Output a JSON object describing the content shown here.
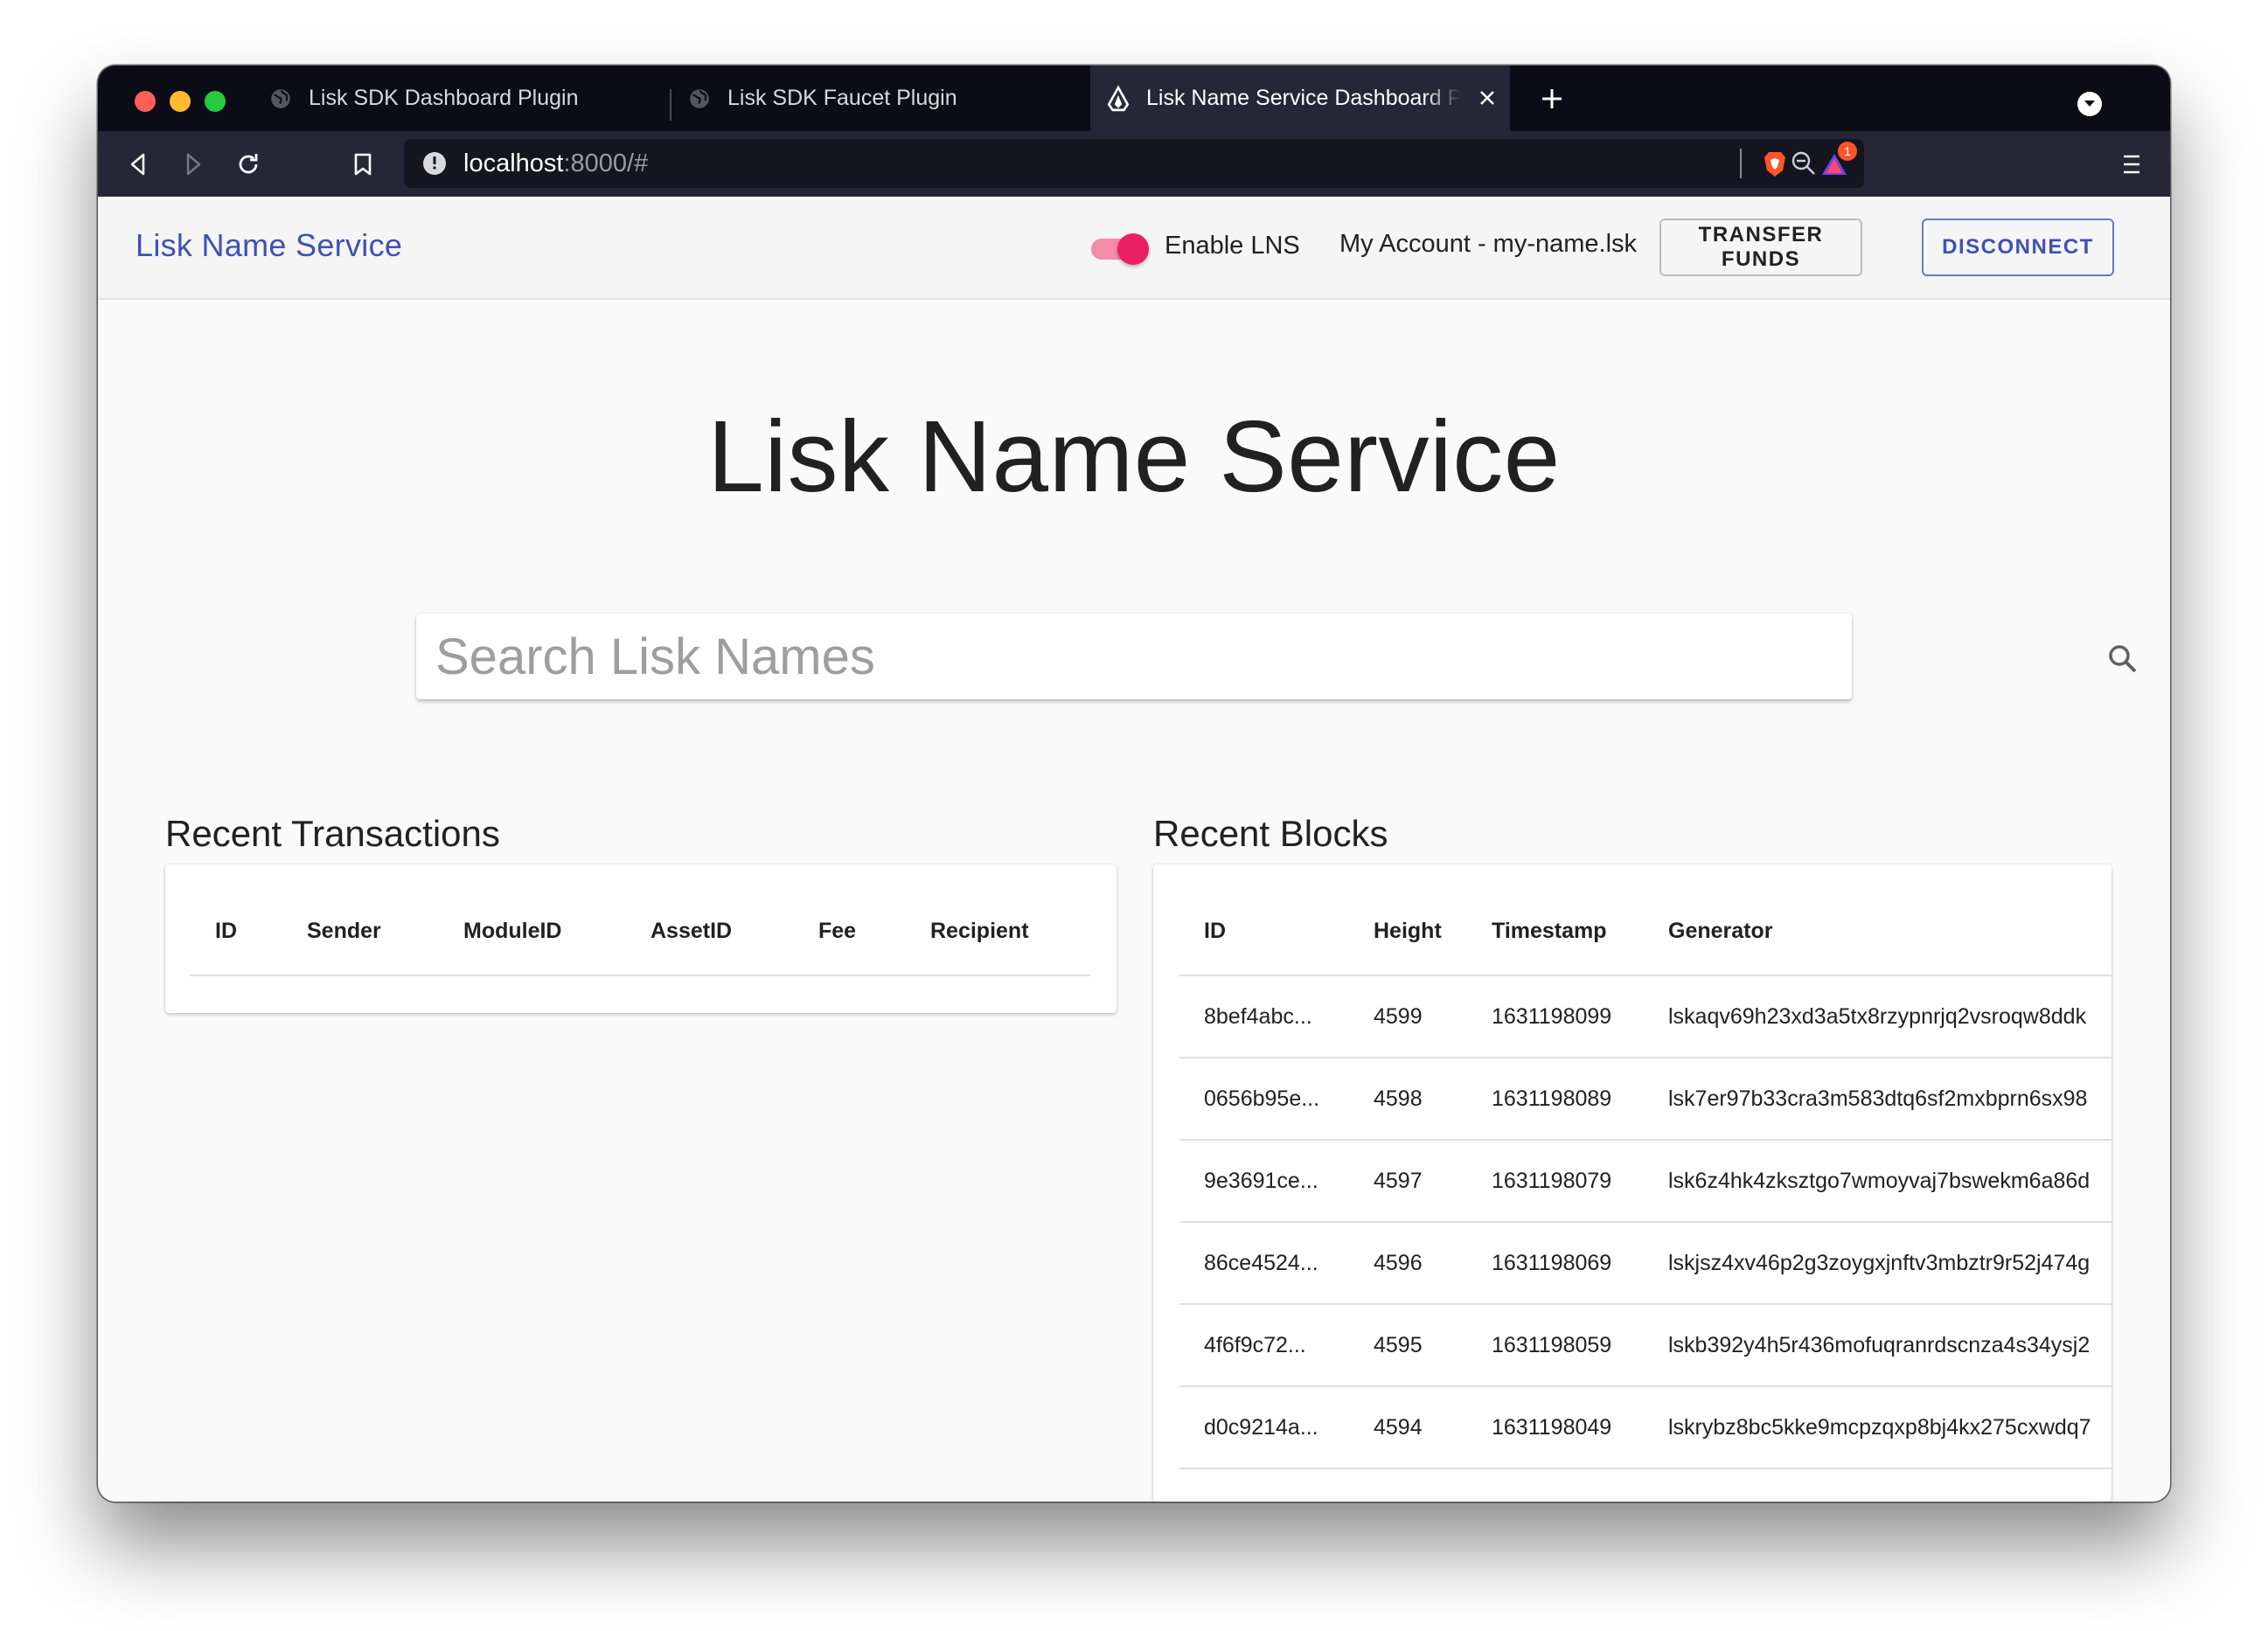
{
  "browser": {
    "tabs": [
      {
        "title": "Lisk SDK Dashboard Plugin",
        "active": false
      },
      {
        "title": "Lisk SDK Faucet Plugin",
        "active": false
      },
      {
        "title": "Lisk Name Service Dashboard P",
        "active": true
      }
    ],
    "url_host": "localhost",
    "url_rest": ":8000/#",
    "badge_count": "1"
  },
  "appbar": {
    "brand": "Lisk Name Service",
    "toggle_label": "Enable LNS",
    "toggle_on": true,
    "account": "My Account - my-name.lsk",
    "transfer_button": "TRANSFER FUNDS",
    "disconnect_button": "DISCONNECT"
  },
  "hero": {
    "title": "Lisk Name Service"
  },
  "search": {
    "placeholder": "Search Lisk Names"
  },
  "transactions": {
    "title": "Recent Transactions",
    "columns": [
      "ID",
      "Sender",
      "ModuleID",
      "AssetID",
      "Fee",
      "Recipient"
    ],
    "rows": []
  },
  "blocks": {
    "title": "Recent Blocks",
    "columns": [
      "ID",
      "Height",
      "Timestamp",
      "Generator"
    ],
    "rows": [
      {
        "id": "8bef4abc...",
        "height": "4599",
        "timestamp": "1631198099",
        "generator": "lskaqv69h23xd3a5tx8rzypnrjq2vsroqw8ddk"
      },
      {
        "id": "0656b95e...",
        "height": "4598",
        "timestamp": "1631198089",
        "generator": "lsk7er97b33cra3m583dtq6sf2mxbprn6sx98"
      },
      {
        "id": "9e3691ce...",
        "height": "4597",
        "timestamp": "1631198079",
        "generator": "lsk6z4hk4zksztgo7wmoyvaj7bswekm6a86d"
      },
      {
        "id": "86ce4524...",
        "height": "4596",
        "timestamp": "1631198069",
        "generator": "lskjsz4xv46p2g3zoygxjnftv3mbztr9r52j474g"
      },
      {
        "id": "4f6f9c72...",
        "height": "4595",
        "timestamp": "1631198059",
        "generator": "lskb392y4h5r436mofuqranrdscnza4s34ysj2"
      },
      {
        "id": "d0c9214a...",
        "height": "4594",
        "timestamp": "1631198049",
        "generator": "lskrybz8bc5kke9mcpzqxp8bj4kx275cxwdq7"
      }
    ]
  },
  "colors": {
    "brand": "#3f51b5",
    "toggle": "#e91e63"
  }
}
